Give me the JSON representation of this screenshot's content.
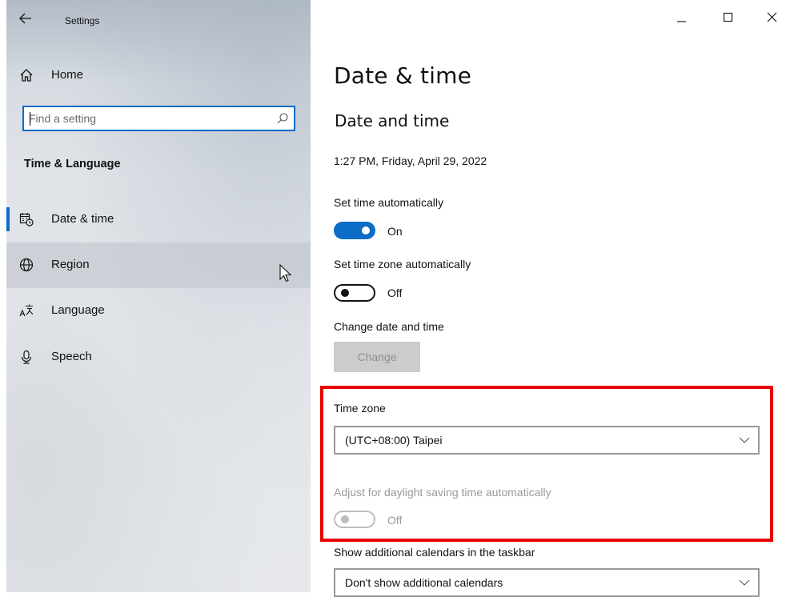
{
  "window": {
    "app_title": "Settings",
    "minimize_glyph": "—",
    "maximize_glyph": "☐",
    "close_glyph": "✕"
  },
  "sidebar": {
    "home_label": "Home",
    "search_placeholder": "Find a setting",
    "section_heading": "Time & Language",
    "items": [
      {
        "label": "Date & time",
        "icon": "calendar-clock-icon",
        "selected": true
      },
      {
        "label": "Region",
        "icon": "globe-icon",
        "hovered": true
      },
      {
        "label": "Language",
        "icon": "language-icon"
      },
      {
        "label": "Speech",
        "icon": "microphone-icon"
      }
    ]
  },
  "main": {
    "page_title": "Date & time",
    "sub_heading": "Date and time",
    "current_datetime": "1:27 PM, Friday, April 29, 2022",
    "set_time_auto": {
      "label": "Set time automatically",
      "state": "On"
    },
    "set_timezone_auto": {
      "label": "Set time zone automatically",
      "state": "Off"
    },
    "change_date_time": {
      "label": "Change date and time",
      "button": "Change"
    },
    "time_zone": {
      "label": "Time zone",
      "value": "(UTC+08:00) Taipei"
    },
    "daylight_saving": {
      "label": "Adjust for daylight saving time automatically",
      "state": "Off"
    },
    "additional_calendars": {
      "label": "Show additional calendars in the taskbar",
      "value": "Don't show additional calendars"
    }
  },
  "colors": {
    "accent": "#0a6cc4",
    "highlight": "#e60000",
    "disabled_text": "#9a9a9a"
  }
}
